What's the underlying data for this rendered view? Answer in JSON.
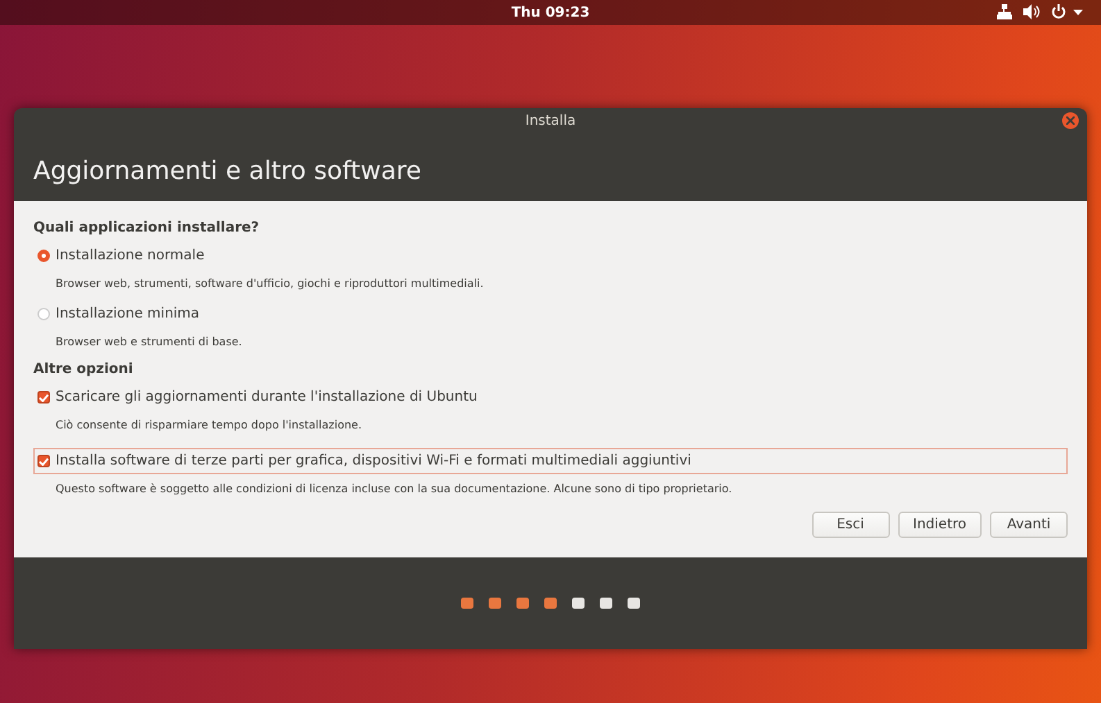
{
  "top_bar": {
    "clock": "Thu 09:23"
  },
  "window": {
    "title": "Installa",
    "heading": "Aggiornamenti e altro software"
  },
  "sections": [
    {
      "heading": "Quali applicazioni installare?",
      "options": [
        {
          "kind": "radio",
          "label": "Installazione normale",
          "description": "Browser web, strumenti, software d'ufficio, giochi e riproduttori multimediali.",
          "selected": true,
          "focused": false
        },
        {
          "kind": "radio",
          "label": "Installazione minima",
          "description": "Browser web e strumenti di base.",
          "selected": false,
          "focused": false
        }
      ]
    },
    {
      "heading": "Altre opzioni",
      "options": [
        {
          "kind": "checkbox",
          "label": "Scaricare gli aggiornamenti durante l'installazione di Ubuntu",
          "description": "Ciò consente di risparmiare tempo dopo l'installazione.",
          "checked": true,
          "focused": false
        },
        {
          "kind": "checkbox",
          "label": "Installa software di terze parti per grafica, dispositivi Wi-Fi e formati multimediali aggiuntivi",
          "description": "Questo software è soggetto alle condizioni di licenza incluse con la sua documentazione. Alcune sono di tipo proprietario.",
          "checked": true,
          "focused": true
        }
      ]
    }
  ],
  "buttons": [
    "Esci",
    "Indietro",
    "Avanti"
  ],
  "progress_steps": [
    {
      "done": true
    },
    {
      "done": true
    },
    {
      "done": true
    },
    {
      "done": true
    },
    {
      "done": false
    },
    {
      "done": false
    },
    {
      "done": false
    }
  ]
}
